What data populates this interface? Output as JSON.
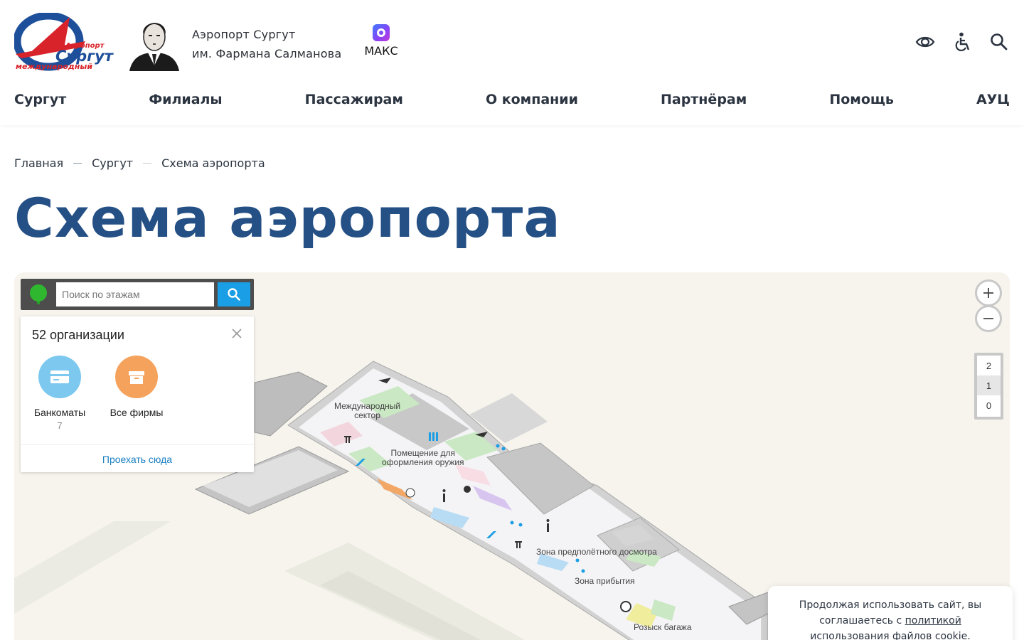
{
  "header": {
    "airport_name_line1": "Аэропорт Сургут",
    "airport_name_line2": "им. Фармана Салманова",
    "logo_text": {
      "top": "Аэропорт",
      "main": "Сургут",
      "bottom": "международный"
    },
    "maks_label": "МАКС",
    "icons": [
      "eye-icon",
      "wheelchair-icon",
      "search-icon"
    ]
  },
  "nav": {
    "items": [
      {
        "label": "Сургут"
      },
      {
        "label": "Филиалы"
      },
      {
        "label": "Пассажирам"
      },
      {
        "label": "О компании"
      },
      {
        "label": "Партнёрам"
      },
      {
        "label": "Помощь"
      },
      {
        "label": "АУЦ"
      }
    ]
  },
  "breadcrumb": {
    "items": [
      "Главная",
      "Сургут",
      "Схема аэропорта"
    ]
  },
  "page_title": "Схема аэропорта",
  "map": {
    "search_placeholder": "Поиск по этажам",
    "org_count": "52 организации",
    "categories": [
      {
        "label": "Банкоматы",
        "count": "7",
        "color": "#7cc8ef"
      },
      {
        "label": "Все фирмы",
        "count": "",
        "color": "#f5a25d"
      }
    ],
    "route_link": "Проехать сюда",
    "floors": [
      "2",
      "1",
      "0"
    ],
    "active_floor": "1",
    "labels": {
      "international_line1": "Международный",
      "international_line2": "сектор",
      "weapons_line1": "Помещение для",
      "weapons_line2": "оформления оружия",
      "security": "Зона предполётного досмотра",
      "arrival": "Зона прибытия",
      "baggage": "Розыск багажа"
    }
  },
  "cookie": {
    "text_line1": "Продолжая использовать сайт, вы",
    "text_line2_prefix": "соглашаетесь с ",
    "link": "политикой",
    "text_line3": "использования файлов cookie."
  },
  "colors": {
    "brand_blue": "#255085",
    "accent_blue": "#1a9ee5",
    "logo_red": "#d8232a"
  }
}
